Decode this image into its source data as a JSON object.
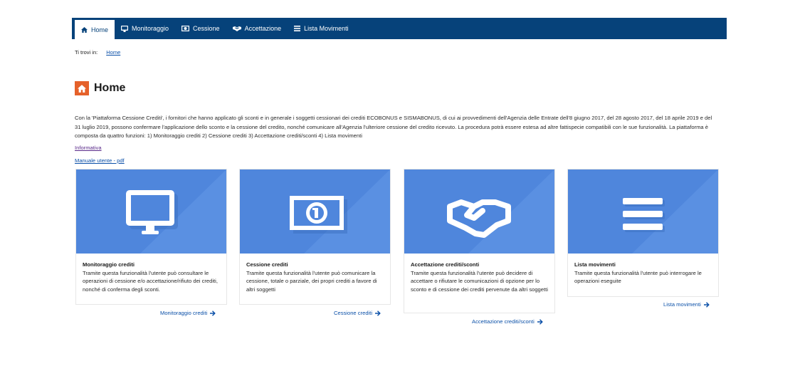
{
  "nav": {
    "items": [
      {
        "label": "Home",
        "icon": "home-icon",
        "active": true
      },
      {
        "label": "Monitoraggio",
        "icon": "monitor-icon",
        "active": false
      },
      {
        "label": "Cessione",
        "icon": "banknote-icon",
        "active": false
      },
      {
        "label": "Accettazione",
        "icon": "handshake-icon",
        "active": false
      },
      {
        "label": "Lista Movimenti",
        "icon": "list-icon",
        "active": false
      }
    ]
  },
  "breadcrumb": {
    "prefix": "Ti trovi in:",
    "current": "Home"
  },
  "page": {
    "title": "Home",
    "intro": "Con la 'Piattaforma Cessione Crediti', i fornitori che hanno applicato gli sconti e in generale i soggetti cessionari dei crediti ECOBONUS e SISMABONUS, di cui ai provvedimenti dell'Agenzia delle Entrate dell'8 giugno 2017, del 28 agosto 2017, del 18 aprile 2019 e del 31 luglio 2019, possono confermare l'applicazione dello sconto e la cessione del credito, nonché comunicare all'Agenzia l'ulteriore cessione del credito ricevuto. La procedura potrà essere estesa ad altre fattispecie compatibili con le sue funzionalità. La piattaforma è composta da quattro funzioni: 1) Monitoraggio crediti 2) Cessione crediti 3) Accettazione crediti/sconti 4) Lista movimenti",
    "links": {
      "informativa": "Informativa",
      "manuale": "Manuale utente - pdf"
    }
  },
  "cards": [
    {
      "title": "Monitoraggio crediti",
      "icon": "monitor-icon",
      "description": "Tramite questa funzionalità l'utente può consultare le operazioni di cessione e/o accettazione/rifiuto dei crediti, nonché di conferma degli sconti.",
      "link": "Monitoraggio crediti"
    },
    {
      "title": "Cessione crediti",
      "icon": "banknote-icon",
      "description": "Tramite questa funzionalità l'utente può comunicare la cessione, totale o parziale, dei propri crediti a favore di altri soggetti",
      "link": "Cessione crediti"
    },
    {
      "title": "Accettazione crediti/sconti",
      "icon": "handshake-icon",
      "description": "Tramite questa funzionalità l'utente può decidere di accettare o rifiutare le comunicazioni di opzione per lo sconto e di cessione dei crediti pervenute da altri soggetti",
      "link": "Accettazione crediti/sconti"
    },
    {
      "title": "Lista movimenti",
      "icon": "list-icon",
      "description": "Tramite questa funzionalità l'utente può interrogare le operazioni eseguite",
      "link": "Lista movimenti"
    }
  ],
  "colors": {
    "nav_bg": "#06427a",
    "card_bg": "#4f86dc",
    "card_shade": "#5a90e2",
    "accent": "#e5612a",
    "link": "#0b50a8"
  }
}
